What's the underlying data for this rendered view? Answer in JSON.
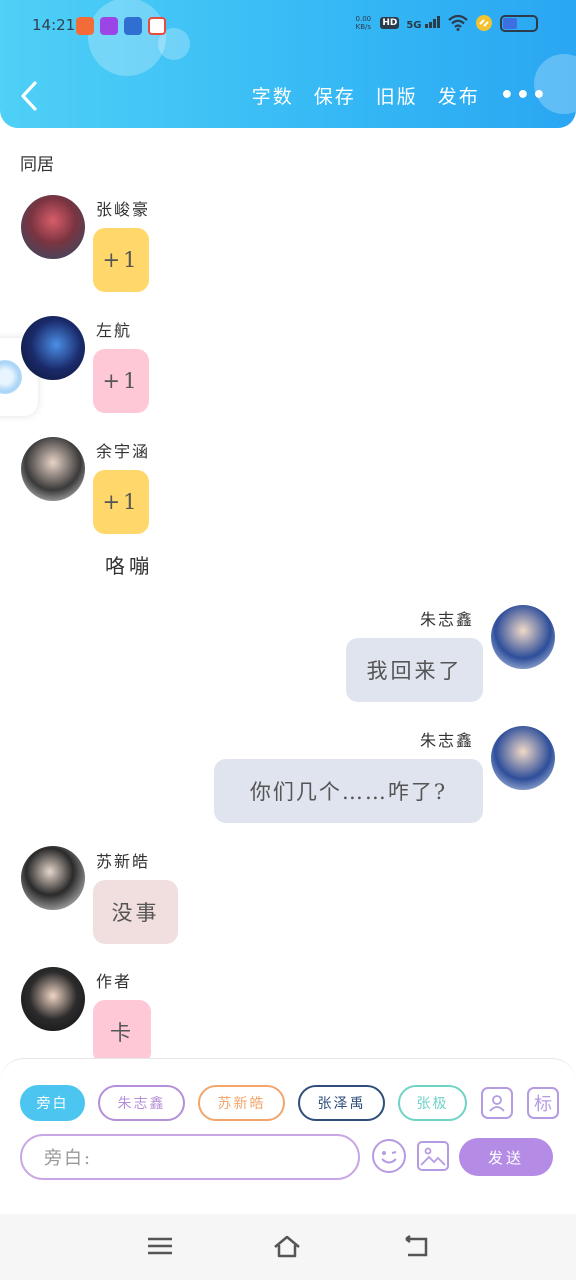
{
  "status_bar": {
    "time": "14:21",
    "network_speed_line1": "0.00",
    "network_speed_line2": "KB/s",
    "hd_label": "HD",
    "signal_label": "5G"
  },
  "header": {
    "actions": [
      "字数",
      "保存",
      "旧版",
      "发布"
    ],
    "more_label": "•••"
  },
  "chat": {
    "title": "同居",
    "messages": [
      {
        "side": "left",
        "name": "张峻豪",
        "text": "+1",
        "bubble_color": "#ffd76b"
      },
      {
        "side": "left",
        "name": "左航",
        "text": "+1",
        "bubble_color": "#ffc8d6"
      },
      {
        "side": "left",
        "name": "余宇涵",
        "text": "+1",
        "bubble_color": "#ffd76b"
      },
      {
        "side": "narration",
        "text": "咯嘣"
      },
      {
        "side": "right",
        "name": "朱志鑫",
        "text": "我回来了",
        "bubble_color": "#dfe4ee"
      },
      {
        "side": "right",
        "name": "朱志鑫",
        "text": "你们几个……咋了?",
        "bubble_color": "#dfe4ee"
      },
      {
        "side": "left",
        "name": "苏新皓",
        "text": "没事",
        "bubble_color": "#f1dede"
      },
      {
        "side": "left",
        "name": "作者",
        "text": "卡",
        "bubble_color": "#ffc8d6"
      }
    ]
  },
  "composer": {
    "roles": [
      {
        "label": "旁白",
        "color": "#4cc6f0",
        "active": true
      },
      {
        "label": "朱志鑫",
        "color": "#b58fd8",
        "active": false
      },
      {
        "label": "苏新皓",
        "color": "#f3a56c",
        "active": false
      },
      {
        "label": "张泽禹",
        "color": "#2f4e7a",
        "active": false
      },
      {
        "label": "张极",
        "color": "#6fd3c6",
        "active": false
      }
    ],
    "tag_label": "标",
    "input_placeholder": "旁白:",
    "send_label": "发送"
  },
  "colors": {
    "header_start": "#4fd0f6",
    "header_end": "#2aa6f2",
    "accent_purple": "#b48ce6"
  }
}
